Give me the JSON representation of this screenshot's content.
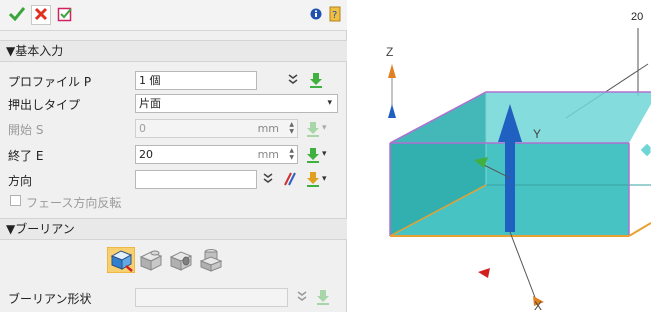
{
  "toolbar": {
    "ok_icon": "check-icon",
    "cancel_icon": "x-icon",
    "apply_icon": "apply-icon",
    "info_icon": "info-icon",
    "help_icon": "help-icon"
  },
  "sections": {
    "basic_input": "▼基本入力",
    "boolean": "▼ブーリアン"
  },
  "fields": {
    "profile": {
      "label": "プロファイル P",
      "value": "1 個"
    },
    "extrude_type": {
      "label": "押出しタイプ",
      "value": "片面"
    },
    "start": {
      "label": "開始 S",
      "value": "0",
      "unit": "mm"
    },
    "end": {
      "label": "終了 E",
      "value": "20",
      "unit": "mm"
    },
    "direction": {
      "label": "方向",
      "value": ""
    },
    "face_flip": {
      "label": "フェース方向反転",
      "checked": false
    },
    "boolean_shape": {
      "label": "ブーリアン形状",
      "value": ""
    }
  },
  "viewport": {
    "axis_z": "Z",
    "axis_y": "Y",
    "axis_x": "X",
    "dimension_label": "20",
    "box_color": "#40c4c4",
    "edge_color": "#b070d0",
    "base_edge_color": "#e8a030",
    "arrow_color": "#2060c0"
  }
}
